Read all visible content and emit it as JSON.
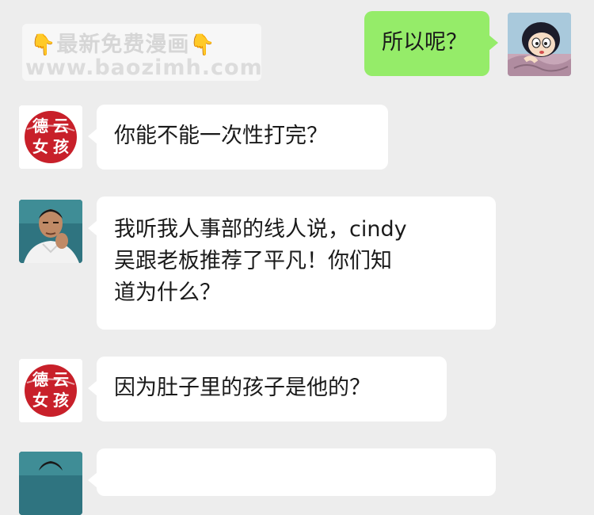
{
  "watermark": {
    "title": "最新免费漫画",
    "url": "www.baozimh.com"
  },
  "colors": {
    "background": "#ededed",
    "incoming_bubble": "#ffffff",
    "outgoing_bubble": "#95ec69"
  },
  "messages": [
    {
      "side": "right",
      "sender": "cartoon-girl",
      "text": "所以呢？"
    },
    {
      "side": "left",
      "sender": "deyun-girl",
      "avatar_text": [
        "德",
        "云",
        "女",
        "孩"
      ],
      "text": "你能不能一次性打完？"
    },
    {
      "side": "left",
      "sender": "man-photo",
      "lines": [
        "我听我人事部的线人说，cindy",
        "吴跟老板推荐了平凡！你们知",
        "道为什么？"
      ]
    },
    {
      "side": "left",
      "sender": "deyun-girl",
      "avatar_text": [
        "德",
        "云",
        "女",
        "孩"
      ],
      "text": "因为肚子里的孩子是他的？"
    },
    {
      "side": "left",
      "sender": "man-photo",
      "text": ""
    }
  ]
}
